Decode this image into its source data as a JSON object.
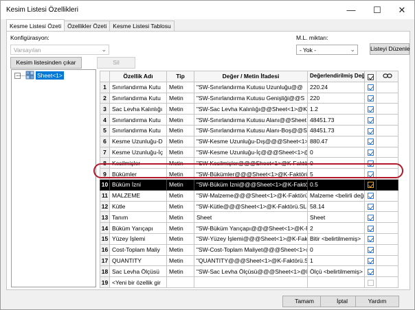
{
  "window": {
    "title": "Kesim Listesi Özellikleri",
    "minimize_glyph": "—",
    "maximize_glyph": "☐",
    "close_glyph": "✕"
  },
  "tabs": [
    "Kesme Listesi Özeti",
    "Özellikler Özeti",
    "Kesme Listesi Tablosu"
  ],
  "config": {
    "label": "Konfigürasyon:",
    "value": "Varsayılan"
  },
  "ml": {
    "label": "M.L. miktarı:",
    "value": "- Yok -"
  },
  "buttons": {
    "edit_list": "Listeyi Düzenle",
    "remove_from_cutlist": "Kesim listesinden çıkar",
    "delete": "Sil",
    "ok": "Tamam",
    "cancel": "İptal",
    "help": "Yardım"
  },
  "tree": {
    "expander": "−",
    "item": "Sheet<1>"
  },
  "table": {
    "headers": [
      "",
      "Özellik Adı",
      "Tip",
      "Değer / Metin İfadesi",
      "Değerlendirilmiş Değer",
      "",
      ""
    ],
    "rows": [
      {
        "num": "1",
        "name": "Sınırlandırma Kutu",
        "type": "Metin",
        "expr": "\"SW-Sınırlandırma Kutusu Uzunluğu@@",
        "value": "220.24",
        "checked": true
      },
      {
        "num": "2",
        "name": "Sınırlandırma Kutu",
        "type": "Metin",
        "expr": "\"SW-Sınırlandırma Kutusu Genişliği@@S",
        "value": "220",
        "checked": true
      },
      {
        "num": "3",
        "name": "Sac Levha Kalınlığı",
        "type": "Metin",
        "expr": "\"SW-Sac Levha Kalınlığı@@Sheet<1>@K-",
        "value": "1.2",
        "checked": true
      },
      {
        "num": "4",
        "name": "Sınırlandırma Kutu",
        "type": "Metin",
        "expr": "\"SW-Sınırlandırma Kutusu Alanı@@Sheet",
        "value": "48451.73",
        "checked": true
      },
      {
        "num": "5",
        "name": "Sınırlandırma Kutu",
        "type": "Metin",
        "expr": "\"SW-Sınırlandırma Kutusu Alanı-Boş@@S",
        "value": "48451.73",
        "checked": true
      },
      {
        "num": "6",
        "name": "Kesme Uzunluğu-D",
        "type": "Metin",
        "expr": "\"SW-Kesme Uzunluğu-Dış@@@Sheet<1>",
        "value": "880.47",
        "checked": true
      },
      {
        "num": "7",
        "name": "Kesme Uzunluğu-İç",
        "type": "Metin",
        "expr": "\"SW-Kesme Uzunluğu-İç@@@Sheet<1>@",
        "value": "0",
        "checked": true
      },
      {
        "num": "8",
        "name": "Kesilmişler",
        "type": "Metin",
        "expr": "\"SW-Kesilmişler@@@Sheet<1>@K-Faktörü",
        "value": "0",
        "checked": true
      },
      {
        "num": "9",
        "name": "Bükümler",
        "type": "Metin",
        "expr": "\"SW-Bükümler@@@Sheet<1>@K-Faktörü.",
        "value": "5",
        "checked": true
      },
      {
        "num": "10",
        "name": "Büküm İzni",
        "type": "Metin",
        "expr": "\"SW-Büküm İzni@@@Sheet<1>@K-Faktör",
        "value": "0.5",
        "checked": true,
        "selected": true
      },
      {
        "num": "11",
        "name": "MALZEME",
        "type": "Metin",
        "expr": "\"SW-Malzeme@@@Sheet<1>@K-Faktörü.",
        "value": "Malzeme <belirli değil",
        "checked": true
      },
      {
        "num": "12",
        "name": "Kütle",
        "type": "Metin",
        "expr": "\"SW-Kütle@@@Sheet<1>@K-Faktörü.SLD",
        "value": "58.14",
        "checked": true
      },
      {
        "num": "13",
        "name": "Tanım",
        "type": "Metin",
        "expr": "Sheet",
        "value": "Sheet",
        "checked": true
      },
      {
        "num": "14",
        "name": "Büküm Yarıçapı",
        "type": "Metin",
        "expr": "\"SW-Büküm Yarıçapı@@@Sheet<1>@K-Fa",
        "value": "2",
        "checked": true
      },
      {
        "num": "15",
        "name": "Yüzey İşlemi",
        "type": "Metin",
        "expr": "\"SW-Yüzey İşlemi@@@Sheet<1>@K-Faktör",
        "value": "Bitir <belirtilmemiş>",
        "checked": true
      },
      {
        "num": "16",
        "name": "Cost-Toplam Maliy",
        "type": "Metin",
        "expr": "\"SW-Cost-Toplam Maliyet@@@Sheet<1>@",
        "value": "0",
        "checked": true
      },
      {
        "num": "17",
        "name": "QUANTITY",
        "type": "Metin",
        "expr": "\"QUANTITY@@@Sheet<1>@K-Faktörü.SLD",
        "value": "1",
        "checked": true
      },
      {
        "num": "18",
        "name": "Sac Levha Ölçüsü",
        "type": "Metin",
        "expr": "\"SW-Sac Levha Ölçüsü@@@Sheet<1>@K-",
        "value": "Ölçü <belirtilmemiş>",
        "checked": true
      },
      {
        "num": "19",
        "name": "<Yeni bir özellik gir",
        "type": "",
        "expr": "",
        "value": "",
        "checked": false
      }
    ]
  },
  "colors": {
    "selection": "#0078d7",
    "highlight_ring": "#b3172a",
    "selected_row": "#000000"
  }
}
